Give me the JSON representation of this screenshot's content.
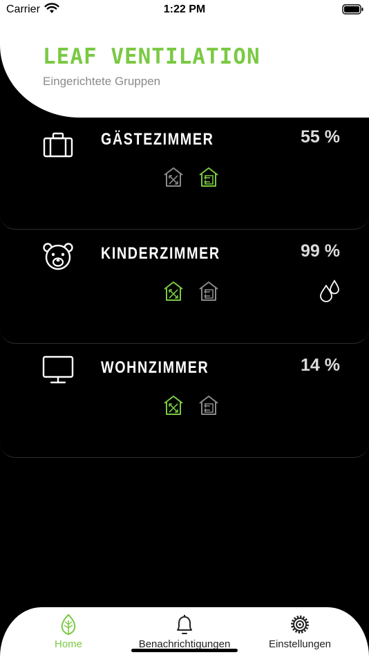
{
  "status_bar": {
    "carrier": "Carrier",
    "time": "1:22 PM"
  },
  "header": {
    "app_title": "LEAF VENTILATION",
    "subtitle": "Eingerichtete Gruppen"
  },
  "rooms": [
    {
      "name": "GÄSTEZIMMER",
      "percent": "55 %",
      "icon": "suitcase-icon",
      "active_mode": "exhaust",
      "humidity_warning": false
    },
    {
      "name": "KINDERZIMMER",
      "percent": "99 %",
      "icon": "teddy-bear-icon",
      "active_mode": "crossflow",
      "humidity_warning": true
    },
    {
      "name": "WOHNZIMMER",
      "percent": "14 %",
      "icon": "monitor-icon",
      "active_mode": "crossflow",
      "humidity_warning": false
    }
  ],
  "tabs": [
    {
      "label": "Home",
      "icon": "leaf-icon",
      "active": true
    },
    {
      "label": "Benachrichtigungen",
      "icon": "bell-icon",
      "active": false
    },
    {
      "label": "Einstellungen",
      "icon": "gear-icon",
      "active": false
    }
  ],
  "colors": {
    "accent": "#7ac943",
    "inactive_icon": "#8a8a8a",
    "background": "#000000",
    "header_bg": "#ffffff"
  }
}
